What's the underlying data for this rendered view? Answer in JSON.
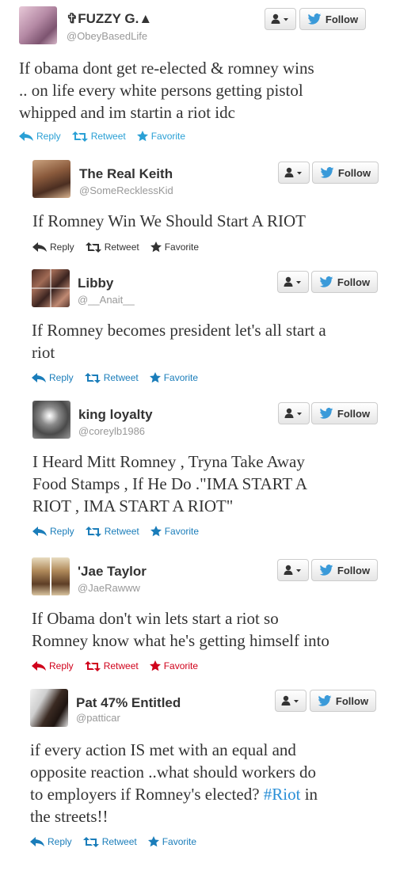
{
  "colors": {
    "link": "#2aa0d5",
    "dark": "#333333",
    "teal": "#1a7dba",
    "red": "#d0021b",
    "twitter_blue": "#3a9ad9"
  },
  "buttons": {
    "follow_label": "Follow",
    "user_menu_icon": "person-dropdown-icon"
  },
  "tweets": [
    {
      "name": "✞FUZZY G.▲",
      "handle": "@ObeyBasedLife",
      "text": "If obama dont get re-elected & romney wins\n.. on life every white persons getting pistol\nwhipped and im startin a riot idc",
      "actions": {
        "reply": "Reply",
        "retweet": "Retweet",
        "favorite": "Favorite"
      },
      "action_color": "#2aa0d5"
    },
    {
      "name": "The Real Keith",
      "handle": "@SomeRecklessKid",
      "text": "If Romney Win We Should Start A RIOT",
      "actions": {
        "reply": "Reply",
        "retweet": "Retweet",
        "favorite": "Favorite"
      },
      "action_color": "#333333"
    },
    {
      "name": "Libby",
      "handle": "@__Anait__",
      "text": "If Romney becomes president let's all start a\nriot",
      "actions": {
        "reply": "Reply",
        "retweet": "Retweet",
        "favorite": "Favorite"
      },
      "action_color": "#1a7dba"
    },
    {
      "name": "king loyalty",
      "handle": "@coreylb1986",
      "text": "I Heard Mitt Romney , Tryna Take Away\nFood Stamps , If He Do .\"IMA START A\nRIOT , IMA START A RIOT\"",
      "actions": {
        "reply": "Reply",
        "retweet": "Retweet",
        "favorite": "Favorite"
      },
      "action_color": "#1a7dba"
    },
    {
      "name": "'Jae Taylor",
      "handle": "@JaeRawww",
      "text": "If Obama don't win lets start a riot so\nRomney know what he's getting himself into",
      "actions": {
        "reply": "Reply",
        "retweet": "Retweet",
        "favorite": "Favorite"
      },
      "action_color": "#d0021b"
    },
    {
      "name": "Pat 47% Entitled",
      "handle": "@patticar",
      "text_before": "if every action IS met with an equal and\nopposite reaction ..what should workers do\nto employers if Romney's elected? ",
      "hashtag": "#Riot",
      "text_after": " in\nthe streets!!",
      "actions": {
        "reply": "Reply",
        "retweet": "Retweet",
        "favorite": "Favorite"
      },
      "action_color": "#1a7dba"
    }
  ]
}
